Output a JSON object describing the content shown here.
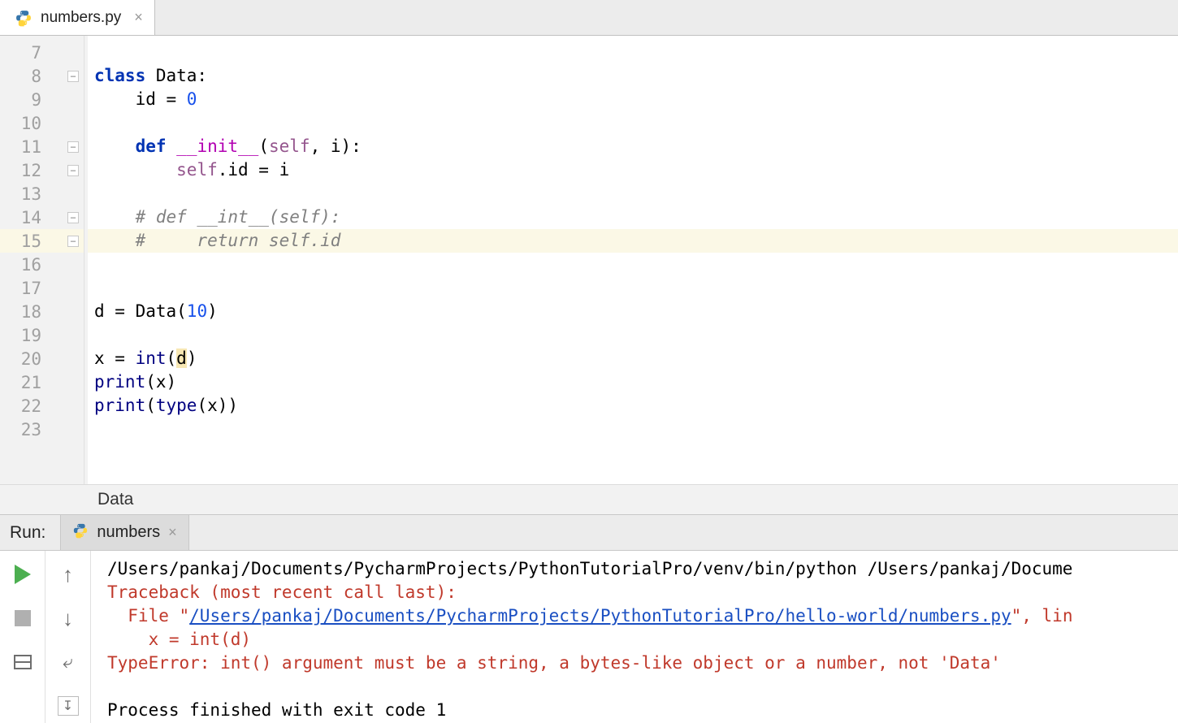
{
  "tab": {
    "filename": "numbers.py"
  },
  "gutter": {
    "start": 7,
    "end": 23,
    "highlighted": 15
  },
  "code": {
    "l7": "",
    "l8_class": "class",
    "l8_name": " Data:",
    "l9_a": "    id = ",
    "l9_b": "0",
    "l10": "",
    "l11_a": "    ",
    "l11_def": "def",
    "l11_b": " ",
    "l11_dunder": "__init__",
    "l11_c": "(",
    "l11_self": "self",
    "l11_d": ", i):",
    "l12_a": "        ",
    "l12_self": "self",
    "l12_b": ".id = i",
    "l13": "",
    "l14_comment": "    # def __int__(self):",
    "l15_comment": "    #     return self.id",
    "l16": "",
    "l17": "",
    "l18_a": "d = Data(",
    "l18_num": "10",
    "l18_b": ")",
    "l19": "",
    "l20_a": "x = ",
    "l20_builtin": "int",
    "l20_b": "(",
    "l20_d": "d",
    "l20_c": ")",
    "l21_a": "print",
    "l21_b": "(x)",
    "l22_a": "print",
    "l22_b": "(",
    "l22_type": "type",
    "l22_c": "(x))",
    "l23": ""
  },
  "breadcrumb": {
    "path": "Data"
  },
  "run": {
    "label": "Run:",
    "config_name": "numbers"
  },
  "console": {
    "cmd": "/Users/pankaj/Documents/PycharmProjects/PythonTutorialPro/venv/bin/python /Users/pankaj/Docume",
    "tb1": "Traceback (most recent call last):",
    "tb_file_prefix": "  File \"",
    "tb_file_link": "/Users/pankaj/Documents/PycharmProjects/PythonTutorialPro/hello-world/numbers.py",
    "tb_file_suffix": "\", lin",
    "tb_src": "    x = int(d)",
    "tb_err": "TypeError: int() argument must be a string, a bytes-like object or a number, not 'Data'",
    "exit": "Process finished with exit code 1"
  }
}
